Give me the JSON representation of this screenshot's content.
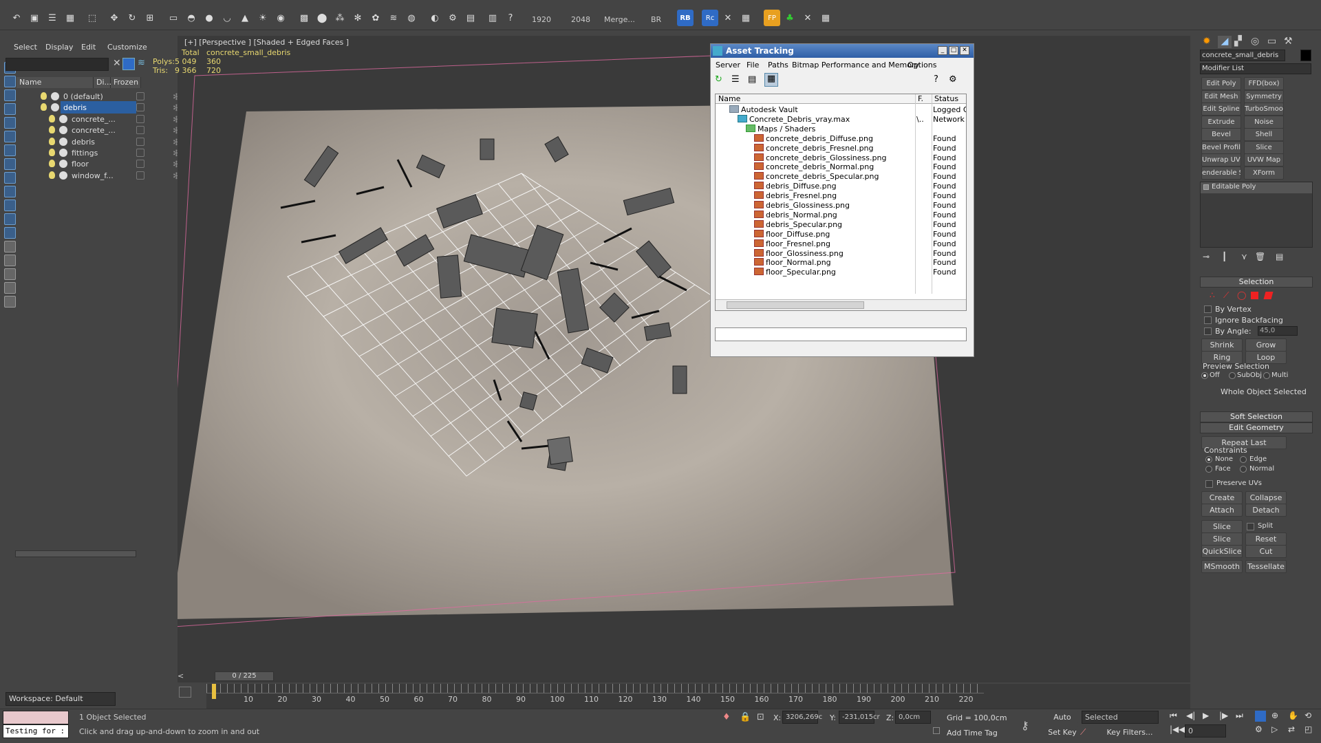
{
  "toolbar": {
    "res_w": "1920",
    "res_h": "2048",
    "merge_label": "Merge...",
    "br_label": "BR",
    "rb_label": "RB",
    "rc_label": "Rc",
    "fp_label": "FP"
  },
  "scene_explorer": {
    "menu": [
      "Select",
      "Display",
      "Edit",
      "Customize"
    ],
    "columns": [
      "Name",
      "Di...",
      "Frozen"
    ],
    "rows": [
      {
        "name": "0 (default)",
        "selected": false
      },
      {
        "name": "debris",
        "selected": true
      },
      {
        "name": "concrete_...",
        "selected": false
      },
      {
        "name": "concrete_...",
        "selected": false
      },
      {
        "name": "debris",
        "selected": false
      },
      {
        "name": "fittings",
        "selected": false
      },
      {
        "name": "floor",
        "selected": false
      },
      {
        "name": "window_f...",
        "selected": false
      }
    ],
    "workspace": "Workspace: Default"
  },
  "viewport": {
    "label": "[+] [Perspective ] [Shaded + Edged Faces ]",
    "stats": {
      "total_label": "Total",
      "object_label": "concrete_small_debris",
      "polys_label": "Polys:",
      "polys_total": "5 049",
      "polys_obj": "360",
      "tris_label": "Tris:",
      "tris_total": "9 366",
      "tris_obj": "720"
    }
  },
  "asset_tracking": {
    "title": "Asset Tracking",
    "menu": [
      "Server",
      "File",
      "Paths",
      "Bitmap Performance and Memory",
      "Options"
    ],
    "columns": [
      "Name",
      "F.",
      "Status"
    ],
    "rows": [
      {
        "name": "Autodesk Vault",
        "f": "",
        "status": "Logged Ou",
        "level": 1
      },
      {
        "name": "Concrete_Debris_vray.max",
        "f": "\\..",
        "status": "Network P",
        "level": 2
      },
      {
        "name": "Maps / Shaders",
        "f": "",
        "status": "",
        "level": 3
      },
      {
        "name": "concrete_debris_Diffuse.png",
        "f": "",
        "status": "Found",
        "level": 4
      },
      {
        "name": "concrete_debris_Fresnel.png",
        "f": "",
        "status": "Found",
        "level": 4
      },
      {
        "name": "concrete_debris_Glossiness.png",
        "f": "",
        "status": "Found",
        "level": 4
      },
      {
        "name": "concrete_debris_Normal.png",
        "f": "",
        "status": "Found",
        "level": 4
      },
      {
        "name": "concrete_debris_Specular.png",
        "f": "",
        "status": "Found",
        "level": 4
      },
      {
        "name": "debris_Diffuse.png",
        "f": "",
        "status": "Found",
        "level": 4
      },
      {
        "name": "debris_Fresnel.png",
        "f": "",
        "status": "Found",
        "level": 4
      },
      {
        "name": "debris_Glossiness.png",
        "f": "",
        "status": "Found",
        "level": 4
      },
      {
        "name": "debris_Normal.png",
        "f": "",
        "status": "Found",
        "level": 4
      },
      {
        "name": "debris_Specular.png",
        "f": "",
        "status": "Found",
        "level": 4
      },
      {
        "name": "floor_Diffuse.png",
        "f": "",
        "status": "Found",
        "level": 4
      },
      {
        "name": "floor_Fresnel.png",
        "f": "",
        "status": "Found",
        "level": 4
      },
      {
        "name": "floor_Glossiness.png",
        "f": "",
        "status": "Found",
        "level": 4
      },
      {
        "name": "floor_Normal.png",
        "f": "",
        "status": "Found",
        "level": 4
      },
      {
        "name": "floor_Specular.png",
        "f": "",
        "status": "Found",
        "level": 4
      }
    ]
  },
  "command_panel": {
    "object_name": "concrete_small_debris",
    "modifier_list": "Modifier List",
    "modifiers": [
      [
        "Edit Poly",
        "FFD(box)"
      ],
      [
        "Edit Mesh",
        "Symmetry"
      ],
      [
        "Edit Spline",
        "TurboSmooth"
      ],
      [
        "Extrude",
        "Noise"
      ],
      [
        "Bevel",
        "Shell"
      ],
      [
        "Bevel Profile",
        "Slice"
      ],
      [
        "Unwrap UVW",
        "UVW Map"
      ],
      [
        "enderable Splin",
        "XForm"
      ]
    ],
    "stack_item": "Editable Poly",
    "selection": {
      "title": "Selection",
      "by_vertex": "By Vertex",
      "ignore_backfacing": "Ignore Backfacing",
      "by_angle": "By Angle:",
      "angle_value": "45,0",
      "shrink": "Shrink",
      "grow": "Grow",
      "ring": "Ring",
      "loop": "Loop",
      "preview_label": "Preview Selection",
      "preview_off": "Off",
      "preview_subobj": "SubObj",
      "preview_multi": "Multi",
      "whole_object": "Whole Object Selected"
    },
    "soft_selection": "Soft Selection",
    "edit_geometry": {
      "title": "Edit Geometry",
      "repeat_last": "Repeat Last",
      "constraints": "Constraints",
      "none": "None",
      "edge": "Edge",
      "face": "Face",
      "normal": "Normal",
      "preserve_uvs": "Preserve UVs",
      "create": "Create",
      "collapse": "Collapse",
      "attach": "Attach",
      "detach": "Detach",
      "slice_plane": "Slice Plane",
      "split": "Split",
      "slice": "Slice",
      "reset_plane": "Reset Plane",
      "quickslice": "QuickSlice",
      "cut": "Cut",
      "msmooth": "MSmooth",
      "tessellate": "Tessellate"
    }
  },
  "timeline": {
    "frame": "0 / 225",
    "ticks": [
      "10",
      "20",
      "30",
      "40",
      "50",
      "60",
      "70",
      "80",
      "90",
      "100",
      "110",
      "120",
      "130",
      "140",
      "150",
      "160",
      "170",
      "180",
      "190",
      "200",
      "210",
      "220"
    ]
  },
  "status": {
    "testing": "Testing for :",
    "selected": "1 Object Selected",
    "prompt": "Click and drag up-and-down to zoom in and out",
    "x_label": "X:",
    "x_value": "3206,269c",
    "y_label": "Y:",
    "y_value": "-231,015cr",
    "z_label": "Z:",
    "z_value": "0,0cm",
    "grid": "Grid = 100,0cm",
    "add_time_tag": "Add Time Tag",
    "auto_key": "Auto Key",
    "set_key": "Set Key",
    "selected_dd": "Selected",
    "key_filters": "Key Filters...",
    "frame_field": "0"
  }
}
